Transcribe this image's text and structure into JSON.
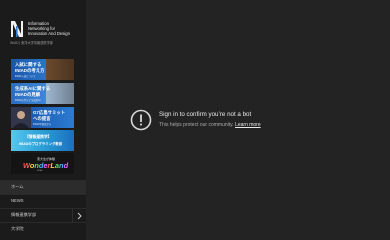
{
  "logo": {
    "line1": "Information",
    "line2": "Networking for",
    "line3": "Innovation And Design",
    "sub": "INIAD | 東洋大学情報連携学部"
  },
  "banners": [
    {
      "t1": "入試に関する",
      "t2": "INIADの考え方",
      "t3": "INIAD入試について"
    },
    {
      "t1": "生成系AIに関する",
      "t2": "INIADの見解",
      "t3": "INIADの学びと生成系AI"
    },
    {
      "t1": "G7広島サミット",
      "t2": "への提言",
      "t3": "INIAD学部長から"
    },
    {
      "t1": "【情報連携学】",
      "t2": "INIADのプログラミング教育",
      "t3": ""
    },
    {
      "t1": "東大生が体験",
      "t2": "WonderLand",
      "t3": "INIAD"
    }
  ],
  "nav": [
    {
      "label": "ホーム",
      "active": true,
      "chevron": false
    },
    {
      "label": "NEWS",
      "active": false,
      "chevron": false
    },
    {
      "label": "情報連携学部",
      "active": false,
      "chevron": true
    },
    {
      "label": "大学院",
      "active": false,
      "chevron": false
    }
  ],
  "overlay": {
    "title": "Sign in to confirm you’re not a bot",
    "body": "This helps protect our community.",
    "link": "Learn more"
  },
  "colors": {
    "background": "#232323",
    "sidebar": "#1b1b1b",
    "accent_blue": "#2a73c9"
  }
}
